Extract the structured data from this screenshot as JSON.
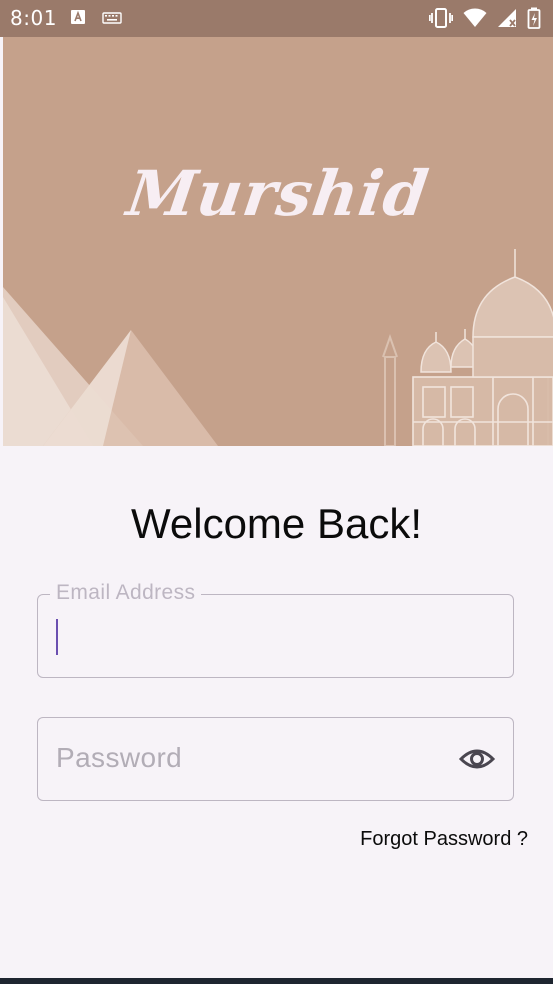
{
  "status_bar": {
    "time": "8:01",
    "icons_left": [
      "text-a-icon",
      "keyboard-icon"
    ],
    "icons_right": [
      "vibrate-icon",
      "wifi-icon",
      "signal-icon",
      "battery-icon"
    ],
    "background": "#9a7a6a"
  },
  "header": {
    "logo_text": "Murshid",
    "background": "#c5a18b"
  },
  "login": {
    "title": "Welcome Back!",
    "email": {
      "label": "Email Address",
      "value": ""
    },
    "password": {
      "placeholder": "Password",
      "toggle_icon": "eye-icon"
    },
    "forgot_link": "Forgot Password ?"
  },
  "colors": {
    "accent": "#6b4fb0",
    "page_background": "#f7f3f8",
    "field_border": "#bdb6c2"
  }
}
